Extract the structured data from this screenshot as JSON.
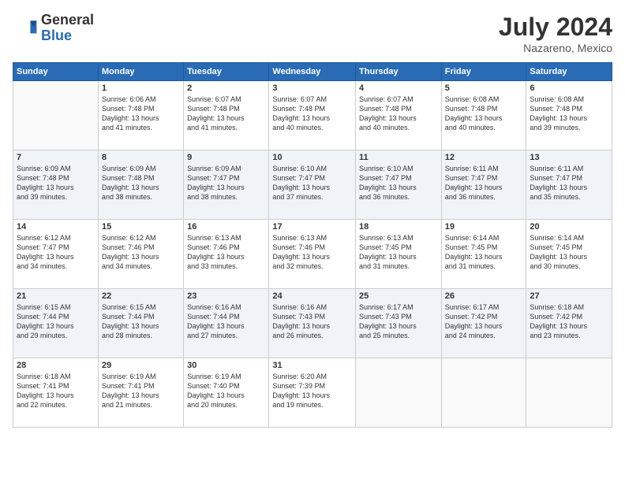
{
  "logo": {
    "general": "General",
    "blue": "Blue"
  },
  "header": {
    "month": "July 2024",
    "location": "Nazareno, Mexico"
  },
  "weekdays": [
    "Sunday",
    "Monday",
    "Tuesday",
    "Wednesday",
    "Thursday",
    "Friday",
    "Saturday"
  ],
  "weeks": [
    [
      {
        "day": "",
        "sunrise": "",
        "sunset": "",
        "daylight": ""
      },
      {
        "day": "1",
        "sunrise": "6:06 AM",
        "sunset": "7:48 PM",
        "daylight": "13 hours and 41 minutes."
      },
      {
        "day": "2",
        "sunrise": "6:07 AM",
        "sunset": "7:48 PM",
        "daylight": "13 hours and 41 minutes."
      },
      {
        "day": "3",
        "sunrise": "6:07 AM",
        "sunset": "7:48 PM",
        "daylight": "13 hours and 40 minutes."
      },
      {
        "day": "4",
        "sunrise": "6:07 AM",
        "sunset": "7:48 PM",
        "daylight": "13 hours and 40 minutes."
      },
      {
        "day": "5",
        "sunrise": "6:08 AM",
        "sunset": "7:48 PM",
        "daylight": "13 hours and 40 minutes."
      },
      {
        "day": "6",
        "sunrise": "6:08 AM",
        "sunset": "7:48 PM",
        "daylight": "13 hours and 39 minutes."
      }
    ],
    [
      {
        "day": "7",
        "sunrise": "6:09 AM",
        "sunset": "7:48 PM",
        "daylight": "13 hours and 39 minutes."
      },
      {
        "day": "8",
        "sunrise": "6:09 AM",
        "sunset": "7:48 PM",
        "daylight": "13 hours and 38 minutes."
      },
      {
        "day": "9",
        "sunrise": "6:09 AM",
        "sunset": "7:47 PM",
        "daylight": "13 hours and 38 minutes."
      },
      {
        "day": "10",
        "sunrise": "6:10 AM",
        "sunset": "7:47 PM",
        "daylight": "13 hours and 37 minutes."
      },
      {
        "day": "11",
        "sunrise": "6:10 AM",
        "sunset": "7:47 PM",
        "daylight": "13 hours and 36 minutes."
      },
      {
        "day": "12",
        "sunrise": "6:11 AM",
        "sunset": "7:47 PM",
        "daylight": "13 hours and 36 minutes."
      },
      {
        "day": "13",
        "sunrise": "6:11 AM",
        "sunset": "7:47 PM",
        "daylight": "13 hours and 35 minutes."
      }
    ],
    [
      {
        "day": "14",
        "sunrise": "6:12 AM",
        "sunset": "7:47 PM",
        "daylight": "13 hours and 34 minutes."
      },
      {
        "day": "15",
        "sunrise": "6:12 AM",
        "sunset": "7:46 PM",
        "daylight": "13 hours and 34 minutes."
      },
      {
        "day": "16",
        "sunrise": "6:13 AM",
        "sunset": "7:46 PM",
        "daylight": "13 hours and 33 minutes."
      },
      {
        "day": "17",
        "sunrise": "6:13 AM",
        "sunset": "7:46 PM",
        "daylight": "13 hours and 32 minutes."
      },
      {
        "day": "18",
        "sunrise": "6:13 AM",
        "sunset": "7:45 PM",
        "daylight": "13 hours and 31 minutes."
      },
      {
        "day": "19",
        "sunrise": "6:14 AM",
        "sunset": "7:45 PM",
        "daylight": "13 hours and 31 minutes."
      },
      {
        "day": "20",
        "sunrise": "6:14 AM",
        "sunset": "7:45 PM",
        "daylight": "13 hours and 30 minutes."
      }
    ],
    [
      {
        "day": "21",
        "sunrise": "6:15 AM",
        "sunset": "7:44 PM",
        "daylight": "13 hours and 29 minutes."
      },
      {
        "day": "22",
        "sunrise": "6:15 AM",
        "sunset": "7:44 PM",
        "daylight": "13 hours and 28 minutes."
      },
      {
        "day": "23",
        "sunrise": "6:16 AM",
        "sunset": "7:44 PM",
        "daylight": "13 hours and 27 minutes."
      },
      {
        "day": "24",
        "sunrise": "6:16 AM",
        "sunset": "7:43 PM",
        "daylight": "13 hours and 26 minutes."
      },
      {
        "day": "25",
        "sunrise": "6:17 AM",
        "sunset": "7:43 PM",
        "daylight": "13 hours and 25 minutes."
      },
      {
        "day": "26",
        "sunrise": "6:17 AM",
        "sunset": "7:42 PM",
        "daylight": "13 hours and 24 minutes."
      },
      {
        "day": "27",
        "sunrise": "6:18 AM",
        "sunset": "7:42 PM",
        "daylight": "13 hours and 23 minutes."
      }
    ],
    [
      {
        "day": "28",
        "sunrise": "6:18 AM",
        "sunset": "7:41 PM",
        "daylight": "13 hours and 22 minutes."
      },
      {
        "day": "29",
        "sunrise": "6:19 AM",
        "sunset": "7:41 PM",
        "daylight": "13 hours and 21 minutes."
      },
      {
        "day": "30",
        "sunrise": "6:19 AM",
        "sunset": "7:40 PM",
        "daylight": "13 hours and 20 minutes."
      },
      {
        "day": "31",
        "sunrise": "6:20 AM",
        "sunset": "7:39 PM",
        "daylight": "13 hours and 19 minutes."
      },
      {
        "day": "",
        "sunrise": "",
        "sunset": "",
        "daylight": ""
      },
      {
        "day": "",
        "sunrise": "",
        "sunset": "",
        "daylight": ""
      },
      {
        "day": "",
        "sunrise": "",
        "sunset": "",
        "daylight": ""
      }
    ]
  ],
  "labels": {
    "sunrise": "Sunrise:",
    "sunset": "Sunset:",
    "daylight": "Daylight:"
  }
}
